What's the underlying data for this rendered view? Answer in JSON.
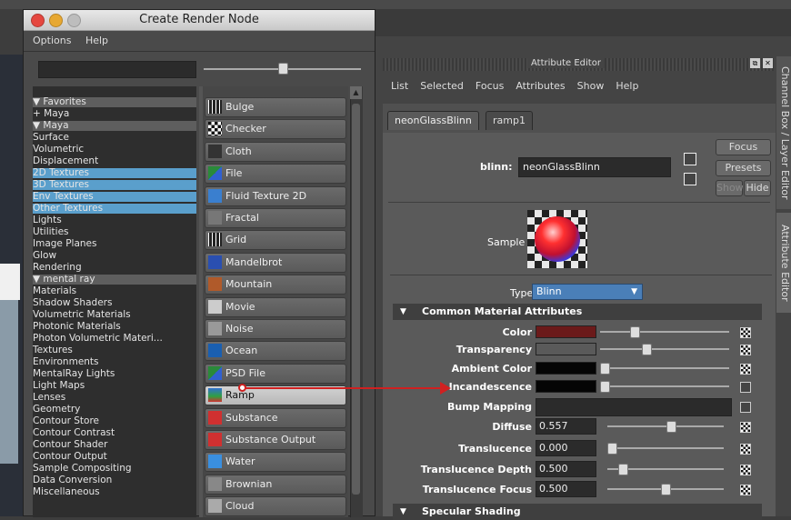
{
  "dialog": {
    "title": "Create Render Node",
    "menu": [
      "Options",
      "Help"
    ]
  },
  "tree": [
    {
      "label": "▼  Favorites",
      "kind": "hdr"
    },
    {
      "label": "    + Maya",
      "kind": "item"
    },
    {
      "label": "▼  Maya",
      "kind": "hdr"
    },
    {
      "label": "    Surface",
      "kind": "item"
    },
    {
      "label": "    Volumetric",
      "kind": "item"
    },
    {
      "label": "    Displacement",
      "kind": "item"
    },
    {
      "label": "    2D Textures",
      "kind": "sel"
    },
    {
      "label": "    3D Textures",
      "kind": "sel"
    },
    {
      "label": "    Env Textures",
      "kind": "sel"
    },
    {
      "label": "    Other Textures",
      "kind": "sel"
    },
    {
      "label": "    Lights",
      "kind": "item"
    },
    {
      "label": "    Utilities",
      "kind": "item"
    },
    {
      "label": "    Image Planes",
      "kind": "item"
    },
    {
      "label": "    Glow",
      "kind": "item"
    },
    {
      "label": "    Rendering",
      "kind": "item"
    },
    {
      "label": "▼  mental ray",
      "kind": "hdr"
    },
    {
      "label": "    Materials",
      "kind": "item"
    },
    {
      "label": "    Shadow Shaders",
      "kind": "item"
    },
    {
      "label": "    Volumetric Materials",
      "kind": "item"
    },
    {
      "label": "    Photonic Materials",
      "kind": "item"
    },
    {
      "label": "    Photon Volumetric Materi...",
      "kind": "item"
    },
    {
      "label": "    Textures",
      "kind": "item"
    },
    {
      "label": "    Environments",
      "kind": "item"
    },
    {
      "label": "    MentalRay Lights",
      "kind": "item"
    },
    {
      "label": "    Light Maps",
      "kind": "item"
    },
    {
      "label": "    Lenses",
      "kind": "item"
    },
    {
      "label": "    Geometry",
      "kind": "item"
    },
    {
      "label": "    Contour Store",
      "kind": "item"
    },
    {
      "label": "    Contour Contrast",
      "kind": "item"
    },
    {
      "label": "    Contour Shader",
      "kind": "item"
    },
    {
      "label": "    Contour Output",
      "kind": "item"
    },
    {
      "label": "    Sample Compositing",
      "kind": "item"
    },
    {
      "label": "    Data Conversion",
      "kind": "item"
    },
    {
      "label": "    Miscellaneous",
      "kind": "item"
    }
  ],
  "nodes": [
    {
      "label": "Bulge",
      "icon": "bulge-icon",
      "color": "#222222"
    },
    {
      "label": "Checker",
      "icon": "checker-icon",
      "color": "#ffffff"
    },
    {
      "label": "Cloth",
      "icon": "cloth-icon",
      "color": "#333333"
    },
    {
      "label": "File",
      "icon": "file-icon",
      "color": "#2a8a3a"
    },
    {
      "label": "Fluid Texture 2D",
      "icon": "fluid-icon",
      "color": "#3a7fcf"
    },
    {
      "label": "Fractal",
      "icon": "fractal-icon",
      "color": "#777777"
    },
    {
      "label": "Grid",
      "icon": "grid-icon",
      "color": "#111111"
    },
    {
      "label": "Mandelbrot",
      "icon": "mandelbrot-icon",
      "color": "#2a4fb0"
    },
    {
      "label": "Mountain",
      "icon": "mountain-icon",
      "color": "#b05a2a"
    },
    {
      "label": "Movie",
      "icon": "movie-icon",
      "color": "#cccccc"
    },
    {
      "label": "Noise",
      "icon": "noise-icon",
      "color": "#999999"
    },
    {
      "label": "Ocean",
      "icon": "ocean-icon",
      "color": "#1a5fb0"
    },
    {
      "label": "PSD File",
      "icon": "psd-icon",
      "color": "#2a8a3a"
    },
    {
      "label": "Ramp",
      "icon": "ramp-icon",
      "color": "#3a9a4a"
    },
    {
      "label": "Substance",
      "icon": "substance-icon",
      "color": "#d03030"
    },
    {
      "label": "Substance Output",
      "icon": "substance-output-icon",
      "color": "#d03030"
    },
    {
      "label": "Water",
      "icon": "water-icon",
      "color": "#3a8fdf"
    },
    {
      "label": "Brownian",
      "icon": "brownian-icon",
      "color": "#888888"
    },
    {
      "label": "Cloud",
      "icon": "cloud-icon",
      "color": "#aaaaaa"
    }
  ],
  "ae": {
    "title": "Attribute Editor",
    "menu": [
      "List",
      "Selected",
      "Focus",
      "Attributes",
      "Show",
      "Help"
    ],
    "tabs": [
      "neonGlassBlinn",
      "ramp1"
    ],
    "blinn_label": "blinn:",
    "blinn_value": "neonGlassBlinn",
    "focus": "Focus",
    "presets": "Presets",
    "show": "Show",
    "hide": "Hide",
    "sample": "Sample",
    "type_label": "Type",
    "type_value": "Blinn",
    "section1": "Common Material Attributes",
    "section2": "Specular Shading",
    "attrs": [
      {
        "label": "Color",
        "kind": "color",
        "swatch": "#6b1a1a",
        "knob": 0.25
      },
      {
        "label": "Transparency",
        "kind": "color",
        "swatch": "#5a5a5a",
        "knob": 0.35
      },
      {
        "label": "Ambient Color",
        "kind": "color",
        "swatch": "#050505",
        "knob": 0.0
      },
      {
        "label": "Incandescence",
        "kind": "color",
        "swatch": "#050505",
        "knob": 0.0
      },
      {
        "label": "Bump Mapping",
        "kind": "bump"
      },
      {
        "label": "Diffuse",
        "kind": "num",
        "value": "0.557",
        "knob": 0.55
      },
      {
        "label": "Translucence",
        "kind": "num",
        "value": "0.000",
        "knob": 0.0
      },
      {
        "label": "Translucence Depth",
        "kind": "num",
        "value": "0.500",
        "knob": 0.1
      },
      {
        "label": "Translucence Focus",
        "kind": "num",
        "value": "0.500",
        "knob": 0.5
      }
    ],
    "side_tabs": [
      "Channel Box / Layer Editor",
      "Attribute Editor"
    ]
  },
  "colors": {
    "selection": "#5a9fcc",
    "arrow": "#d02020"
  }
}
